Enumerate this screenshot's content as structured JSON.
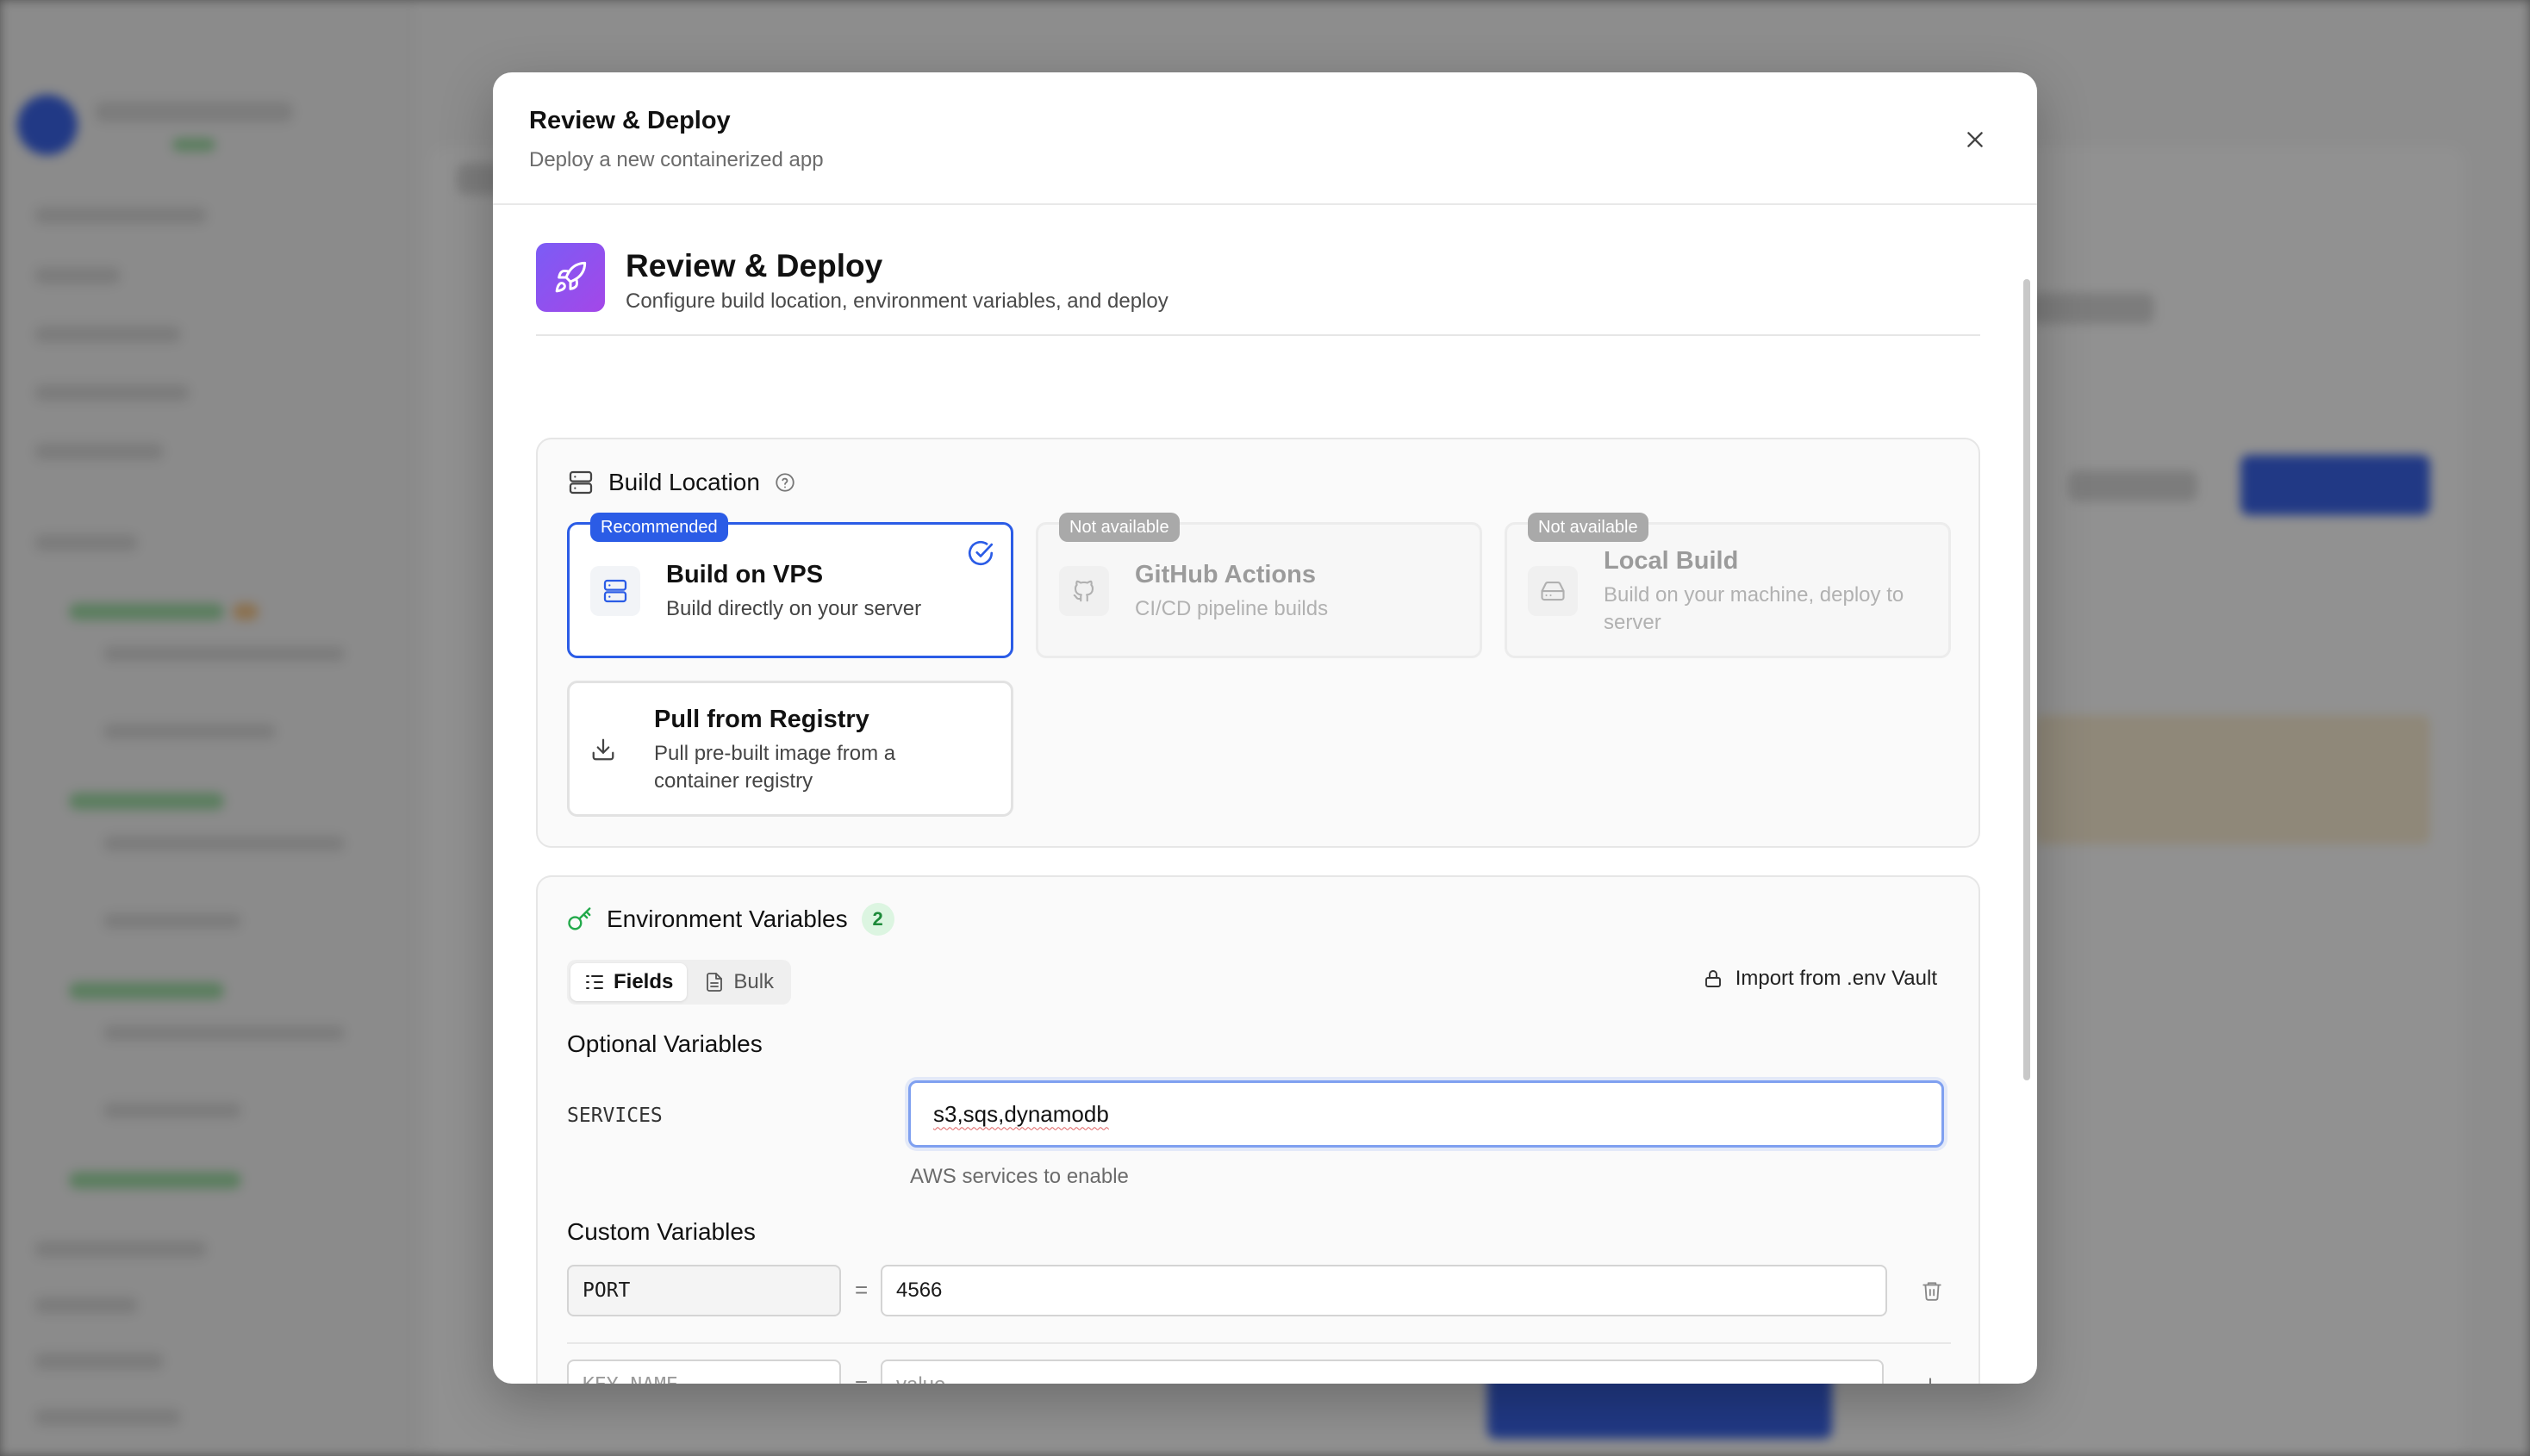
{
  "modal": {
    "title": "Review & Deploy",
    "subtitle": "Deploy a new containerized app"
  },
  "hero": {
    "icon": "rocket-icon",
    "title": "Review & Deploy",
    "subtitle": "Configure build location, environment variables, and deploy"
  },
  "build_location": {
    "title": "Build Location",
    "options": [
      {
        "title": "Build on VPS",
        "desc": "Build directly on your server",
        "badge": "Recommended",
        "icon": "server-icon",
        "state": "selected"
      },
      {
        "title": "GitHub Actions",
        "desc": "CI/CD pipeline builds",
        "badge": "Not available",
        "icon": "github-icon",
        "state": "disabled"
      },
      {
        "title": "Local Build",
        "desc": "Build on your machine, deploy to server",
        "badge": "Not available",
        "icon": "drive-icon",
        "state": "disabled"
      },
      {
        "title": "Pull from Registry",
        "desc": "Pull pre-built image from a container registry",
        "badge": "",
        "icon": "download-icon",
        "state": "default"
      }
    ]
  },
  "env": {
    "title": "Environment Variables",
    "count": "2",
    "tabs": [
      {
        "label": "Fields",
        "active": true
      },
      {
        "label": "Bulk",
        "active": false
      }
    ],
    "import_label": "Import from .env Vault",
    "optional_title": "Optional Variables",
    "optional": {
      "key": "SERVICES",
      "value": "s3,sqs,dynamodb",
      "hint": "AWS services to enable"
    },
    "custom_title": "Custom Variables",
    "custom_rows": [
      {
        "key": "PORT",
        "value": "4566"
      }
    ],
    "new_row": {
      "key_placeholder": "KEY_NAME",
      "value_placeholder": "value"
    },
    "equals": "="
  },
  "colors": {
    "accent": "#2b5ce6",
    "hero_gradient_start": "#7b5cf5",
    "hero_gradient_end": "#a447e8",
    "success": "#1e8a3a"
  }
}
